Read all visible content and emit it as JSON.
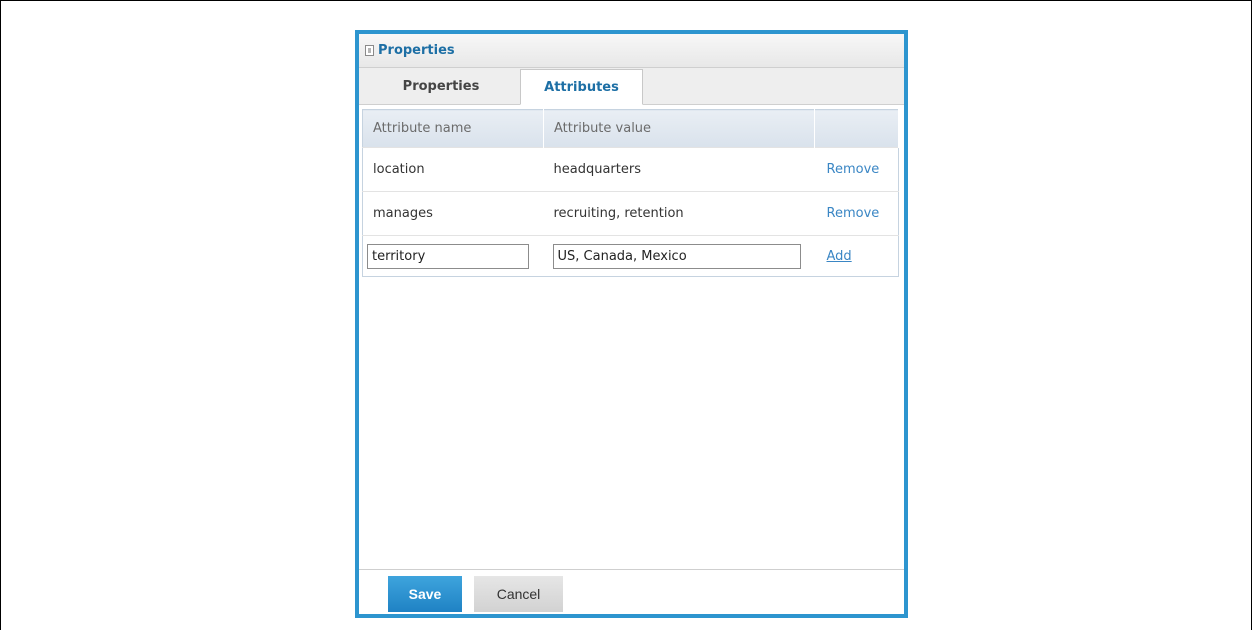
{
  "dialog": {
    "title": "Properties",
    "tabs": [
      {
        "label": "Properties",
        "active": false
      },
      {
        "label": "Attributes",
        "active": true
      }
    ]
  },
  "table": {
    "headers": [
      "Attribute name",
      "Attribute value",
      ""
    ],
    "rows": [
      {
        "name": "location",
        "value": "headquarters",
        "action": "Remove"
      },
      {
        "name": "manages",
        "value": "recruiting, retention",
        "action": "Remove"
      }
    ],
    "new_row": {
      "name_value": "territory",
      "value_value": "US, Canada, Mexico",
      "action": "Add"
    }
  },
  "footer": {
    "save_label": "Save",
    "cancel_label": "Cancel"
  },
  "colors": {
    "accent": "#2d95cf",
    "title_text": "#1d6fa5",
    "link": "#3a86c4"
  },
  "icons": {
    "title_icon": "panel-icon"
  }
}
